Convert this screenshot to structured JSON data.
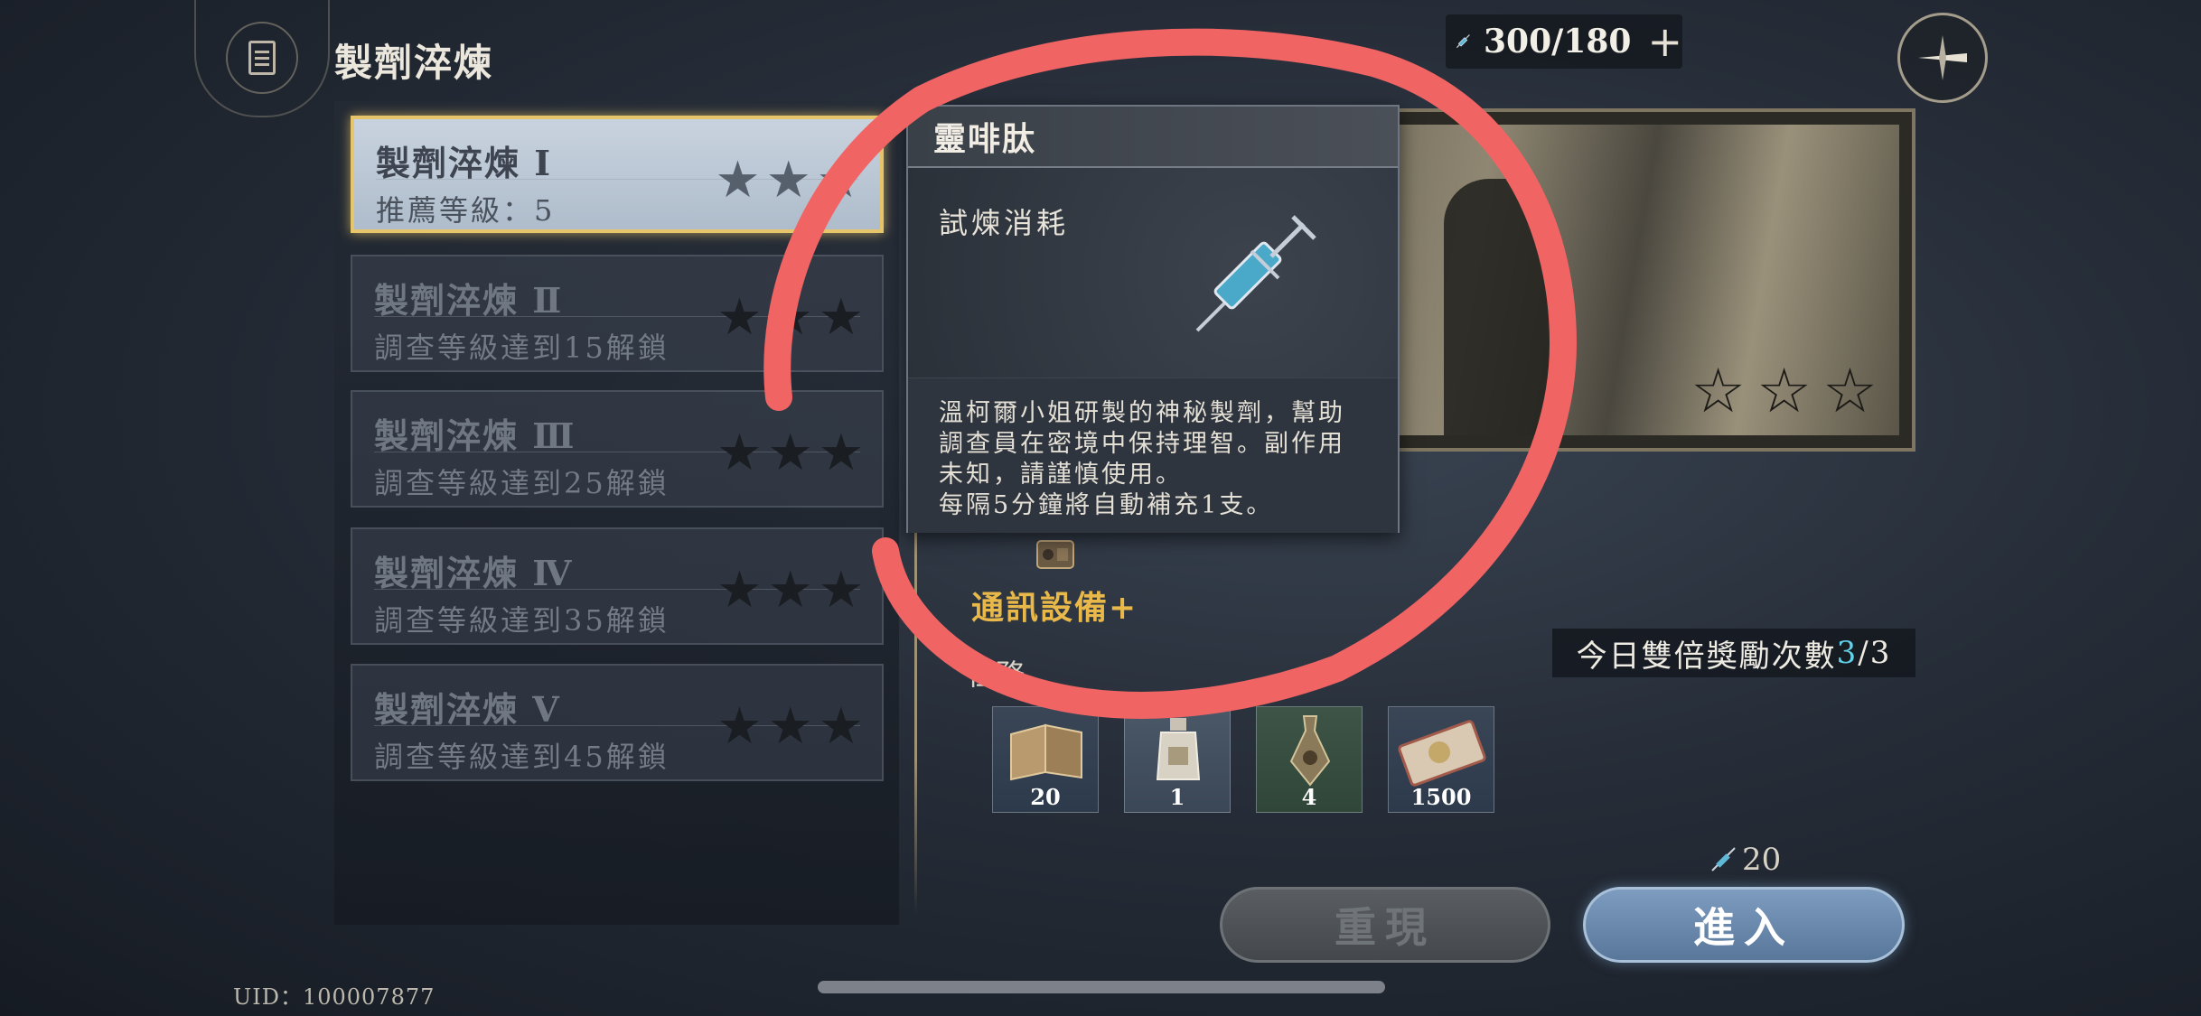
{
  "header": {
    "title": "製劑淬煉",
    "stamina": "300/180",
    "stamina_plus": "+"
  },
  "levels": [
    {
      "name": "製劑淬煉 Ⅰ",
      "sub": "推薦等級：5",
      "stars": 3,
      "active": true
    },
    {
      "name": "製劑淬煉 Ⅱ",
      "sub": "調查等級達到15解鎖",
      "stars": 3,
      "active": false
    },
    {
      "name": "製劑淬煉 Ⅲ",
      "sub": "調查等級達到25解鎖",
      "stars": 3,
      "active": false
    },
    {
      "name": "製劑淬煉 Ⅳ",
      "sub": "調查等級達到35解鎖",
      "stars": 3,
      "active": false
    },
    {
      "name": "製劑淬煉 Ⅴ",
      "sub": "調查等級達到45解鎖",
      "stars": 3,
      "active": false
    }
  ],
  "stage": {
    "stars": 3,
    "comm_label": "通訊設備+",
    "task_label": "任務",
    "double_reward_prefix": "今日雙倍獎勵次數",
    "double_reward_current": "3",
    "double_reward_total": "/3",
    "rewards": [
      {
        "icon": "book-icon",
        "count": "20"
      },
      {
        "icon": "potion-bottle-icon",
        "count": "1"
      },
      {
        "icon": "vial-icon",
        "count": "4"
      },
      {
        "icon": "ticket-icon",
        "count": "1500"
      }
    ],
    "cost": "20",
    "replay_label": "重現",
    "enter_label": "進入"
  },
  "tooltip": {
    "title": "靈啡肽",
    "subtitle": "試煉消耗",
    "desc_lines": [
      "溫柯爾小姐研製的神秘製劑，幫助",
      "調查員在密境中保持理智。副作用",
      "未知，請謹慎使用。",
      "每隔5分鐘將自動補充1支。"
    ]
  },
  "footer": {
    "uid": "UID：100007877"
  },
  "colors": {
    "accent_gold": "#e7c56a",
    "highlight_cyan": "#5fd1e8",
    "annotation_red": "#f06464"
  }
}
